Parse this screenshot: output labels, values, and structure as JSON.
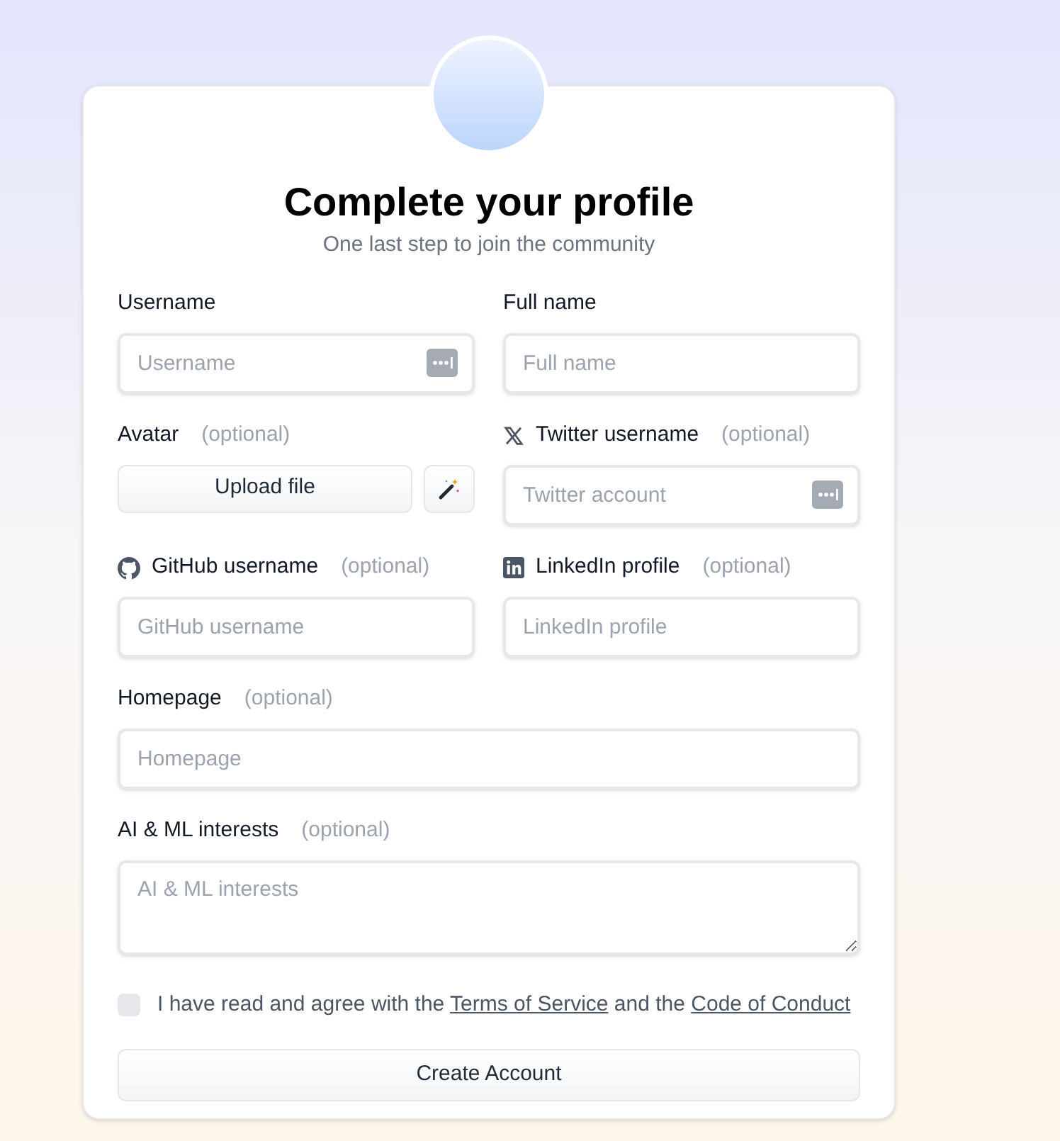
{
  "title": "Complete your profile",
  "subtitle": "One last step to join the community",
  "rows": [
    [
      {
        "kind": "text",
        "label": "Username",
        "placeholder": "Username",
        "autofill": true
      },
      {
        "kind": "text",
        "label": "Full name",
        "placeholder": "Full name",
        "autofill": false
      }
    ],
    [
      {
        "kind": "upload",
        "label": "Avatar",
        "optional": "(optional)",
        "button": "Upload file"
      },
      {
        "kind": "text",
        "icon": {
          "kind": "x"
        },
        "label": "Twitter username",
        "optional": "(optional)",
        "placeholder": "Twitter account",
        "autofill": true
      }
    ],
    [
      {
        "kind": "text",
        "icon": {
          "kind": "github"
        },
        "label": "GitHub username",
        "optional": "(optional)",
        "placeholder": "GitHub username",
        "autofill": false
      },
      {
        "kind": "text",
        "icon": {
          "kind": "linkedin"
        },
        "label": "LinkedIn profile",
        "optional": "(optional)",
        "placeholder": "LinkedIn profile",
        "autofill": false
      }
    ],
    [
      {
        "kind": "text",
        "label": "Homepage",
        "optional": "(optional)",
        "placeholder": "Homepage",
        "autofill": false
      }
    ],
    [
      {
        "kind": "textarea",
        "label": "AI & ML interests",
        "optional": "(optional)",
        "placeholder": "AI & ML interests"
      }
    ]
  ],
  "agreement": {
    "checked": false,
    "text_before": "I have read and agree with the",
    "link_1": "Terms of Service",
    "text_middle": "and the",
    "link_2": "Code of Conduct"
  },
  "submit": "Create Account"
}
